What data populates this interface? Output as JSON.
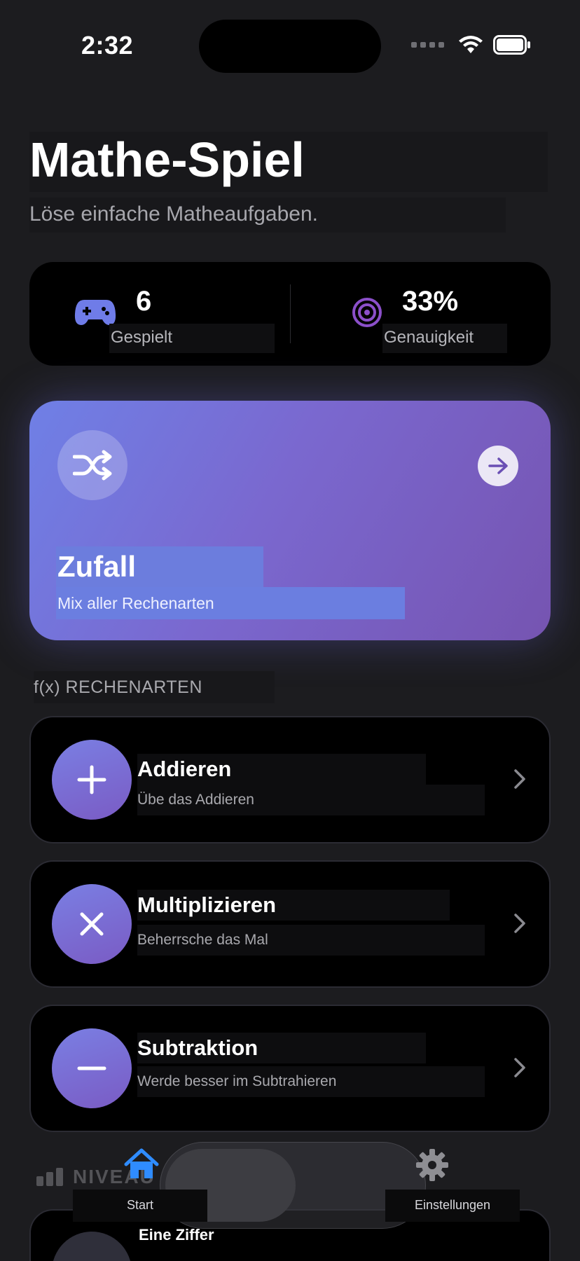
{
  "status_bar": {
    "time": "2:32"
  },
  "header": {
    "title": "Mathe-Spiel",
    "subtitle": "Löse einfache Matheaufgaben."
  },
  "stats": {
    "played": {
      "value": "6",
      "label": "Gespielt",
      "icon": "gamepad-icon"
    },
    "accuracy": {
      "value": "33%",
      "label": "Genauigkeit",
      "icon": "target-icon"
    }
  },
  "random_card": {
    "title": "Zufall",
    "subtitle": "Mix aller Rechenarten",
    "icon": "shuffle-icon",
    "colors": {
      "from": "#6f80e6",
      "to": "#7654b1"
    }
  },
  "operations_section": {
    "header": "f(x) RECHENARTEN",
    "items": [
      {
        "title": "Addieren",
        "subtitle": "Übe das Addieren",
        "icon": "plus-icon"
      },
      {
        "title": "Multiplizieren",
        "subtitle": "Beherrsche das Mal",
        "icon": "multiply-icon"
      },
      {
        "title": "Subtraktion",
        "subtitle": "Werde besser im Subtrahieren",
        "icon": "minus-icon"
      }
    ]
  },
  "levels_section": {
    "header": "NIVEAU",
    "items": [
      {
        "title": "Eine Ziffer"
      }
    ]
  },
  "tab_bar": {
    "tabs": [
      {
        "label": "Start",
        "icon": "home-icon",
        "selected": true
      },
      {
        "label": "Einstellungen",
        "icon": "gear-icon",
        "selected": false
      }
    ],
    "accent": "#2f8cff"
  }
}
